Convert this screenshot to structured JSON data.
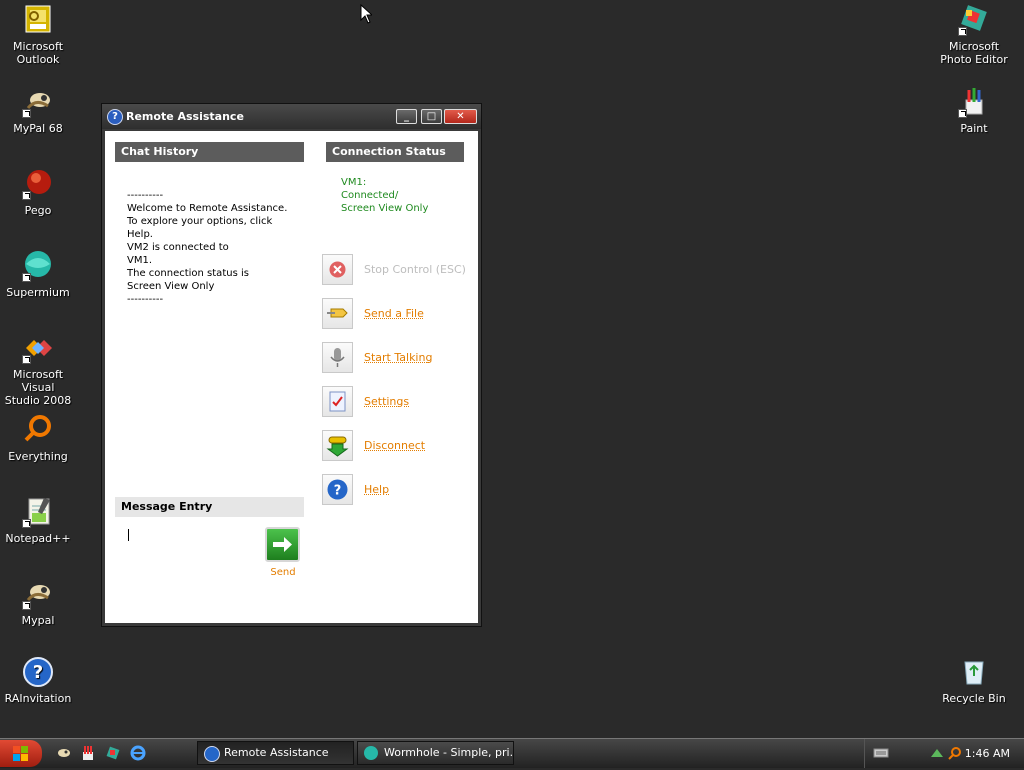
{
  "desktop": {
    "left_icons": [
      {
        "name": "microsoft-outlook",
        "label": "Microsoft\nOutlook"
      },
      {
        "name": "mypal-68",
        "label": "MyPal 68"
      },
      {
        "name": "pego",
        "label": "Pego"
      },
      {
        "name": "supermium",
        "label": "Supermium"
      },
      {
        "name": "visual-studio-2008",
        "label": "Microsoft Visual\nStudio 2008"
      },
      {
        "name": "everything",
        "label": "Everything"
      },
      {
        "name": "notepad-plus-plus",
        "label": "Notepad++"
      },
      {
        "name": "mypal",
        "label": "Mypal"
      },
      {
        "name": "rainvitation",
        "label": "RAInvitation"
      }
    ],
    "right_icons": [
      {
        "name": "microsoft-photo-editor",
        "label": "Microsoft\nPhoto Editor"
      },
      {
        "name": "paint",
        "label": "Paint"
      },
      {
        "name": "recycle-bin",
        "label": "Recycle Bin"
      }
    ]
  },
  "window": {
    "title": "Remote Assistance",
    "chat_history": {
      "heading": "Chat History",
      "text": "----------\nWelcome to Remote Assistance.\nTo explore your options, click\nHelp.\nVM2 is connected to\nVM1.\nThe connection status is\nScreen View Only\n----------"
    },
    "connection_status": {
      "heading": "Connection Status",
      "text": "VM1:\nConnected/\nScreen View Only"
    },
    "actions": [
      {
        "label": "Stop Control (ESC)",
        "enabled": false
      },
      {
        "label": "Send a File",
        "enabled": true
      },
      {
        "label": "Start Talking",
        "enabled": true
      },
      {
        "label": "Settings",
        "enabled": true
      },
      {
        "label": "Disconnect",
        "enabled": true
      },
      {
        "label": "Help",
        "enabled": true
      }
    ],
    "message_entry": {
      "heading": "Message Entry",
      "value": "",
      "send_label": "Send"
    }
  },
  "taskbar": {
    "tasks": [
      {
        "label": "Remote Assistance",
        "active": true
      },
      {
        "label": "Wormhole - Simple, pri...",
        "active": false
      }
    ],
    "clock": "1:46 AM"
  },
  "colors": {
    "desktop_bg": "#2a2a2a",
    "link_orange": "#e37d00",
    "status_green": "#1f8a1f"
  }
}
